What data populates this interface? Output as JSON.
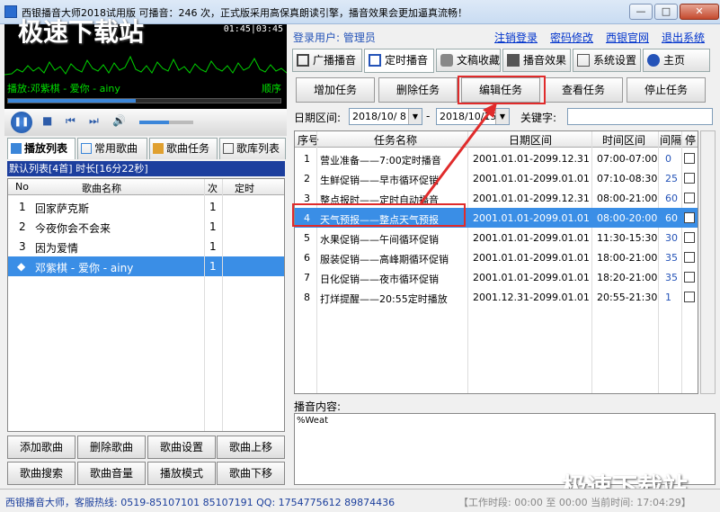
{
  "window": {
    "title": "西银播音大师2018试用版 可播音：246 次，正式版采用高保真朗读引擎，播音效果会更加逼真流畅！",
    "minimize_label": "—",
    "maximize_label": "□",
    "close_label": "✕"
  },
  "watermark": {
    "text": "极速下载站"
  },
  "player": {
    "time": "01:45|03:45",
    "now_playing": "播放:邓紫棋 - 爱你 - ainy",
    "mode": "顺序",
    "progress": 0.47,
    "volume": 0.55
  },
  "left_tabs": [
    {
      "label": "播放列表",
      "active": true
    },
    {
      "label": "常用歌曲",
      "active": false
    },
    {
      "label": "歌曲任务",
      "active": false
    },
    {
      "label": "歌库列表",
      "active": false
    }
  ],
  "playlist": {
    "summary": "默认列表[4首] 时长[16分22秒]",
    "columns": {
      "no": "No",
      "name": "歌曲名称",
      "count": "次",
      "timed": "定时"
    },
    "rows": [
      {
        "no": "1",
        "name": "回家萨克斯",
        "count": "1"
      },
      {
        "no": "2",
        "name": "今夜你会不会来",
        "count": "1"
      },
      {
        "no": "3",
        "name": "因为爱情",
        "count": "1"
      },
      {
        "no": "◆",
        "name": "邓紫棋 - 爱你 - ainy",
        "count": "1"
      }
    ]
  },
  "left_buttons": [
    "添加歌曲",
    "删除歌曲",
    "歌曲设置",
    "歌曲上移",
    "歌曲搜索",
    "歌曲音量",
    "播放模式",
    "歌曲下移"
  ],
  "login": {
    "label": "登录用户: 管理员",
    "links": [
      "注销登录",
      "密码修改",
      "西银官网",
      "退出系统"
    ]
  },
  "main_tabs": [
    {
      "label": "广播播音",
      "active": false
    },
    {
      "label": "定时播音",
      "active": true
    },
    {
      "label": "文稿收藏",
      "active": false
    },
    {
      "label": "播音效果",
      "active": false
    },
    {
      "label": "系统设置",
      "active": false
    },
    {
      "label": "主页",
      "active": false
    }
  ],
  "actions": [
    "增加任务",
    "删除任务",
    "编辑任务",
    "查看任务",
    "停止任务"
  ],
  "filter": {
    "date_label": "日期区间:",
    "date_from": "2018/10/ 8",
    "dash": "-",
    "date_to": "2018/10/15",
    "keyword_label": "关键字:"
  },
  "task_table": {
    "columns": {
      "no": "序号",
      "name": "任务名称",
      "date": "日期区间",
      "time": "时间区间",
      "interval": "间隔",
      "stop": "停"
    },
    "rows": [
      {
        "no": "1",
        "name": "营业准备——7:00定时播音",
        "date": "2001.01.01-2099.12.31",
        "time": "07:00-07:00",
        "interval": "0"
      },
      {
        "no": "2",
        "name": "生鲜促销——早市循环促销",
        "date": "2001.01.01-2099.01.01",
        "time": "07:10-08:30",
        "interval": "25"
      },
      {
        "no": "3",
        "name": "整点报时——定时自动播音",
        "date": "2001.01.01-2099.12.31",
        "time": "08:00-21:00",
        "interval": "60"
      },
      {
        "no": "4",
        "name": "天气预报——整点天气预报",
        "date": "2001.01.01-2099.01.01",
        "time": "08:00-20:00",
        "interval": "60"
      },
      {
        "no": "5",
        "name": "水果促销——午间循环促销",
        "date": "2001.01.01-2099.01.01",
        "time": "11:30-15:30",
        "interval": "30"
      },
      {
        "no": "6",
        "name": "服装促销——高峰期循环促销",
        "date": "2001.01.01-2099.01.01",
        "time": "18:00-21:00",
        "interval": "35"
      },
      {
        "no": "7",
        "name": "日化促销——夜市循环促销",
        "date": "2001.01.01-2099.01.01",
        "time": "18:20-21:00",
        "interval": "35"
      },
      {
        "no": "8",
        "name": "打烊提醒——20:55定时播放",
        "date": "2001.12.31-2099.01.01",
        "time": "20:55-21:30",
        "interval": "1"
      }
    ]
  },
  "content": {
    "label": "播音内容:",
    "text": "%Weat"
  },
  "status": {
    "left": "西银播音大师，客服热线: 0519-85107101 85107191 QQ: 1754775612 89874436",
    "right": "【工作时段: 00:00 至 00:00 当前时间: 17:04:29】"
  },
  "colors": {
    "selection": "#3a8ee6",
    "highlight_box": "#e02b2b",
    "header_bar": "#1d3f9e"
  }
}
